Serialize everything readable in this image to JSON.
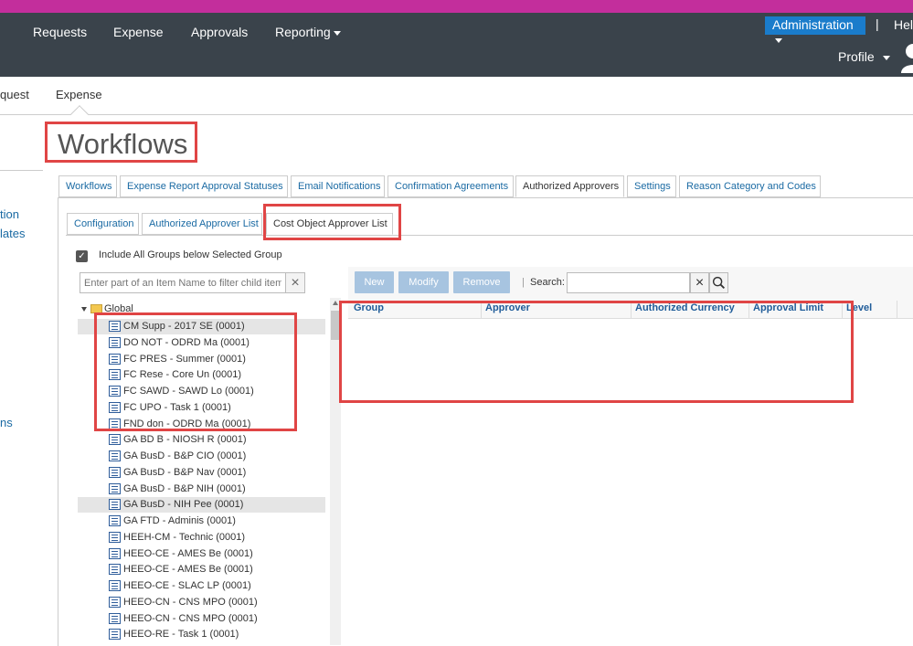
{
  "nav": {
    "items": [
      "Requests",
      "Expense",
      "Approvals",
      "Reporting"
    ],
    "admin": "Administration",
    "separator": "|",
    "help": "Hel",
    "profile": "Profile"
  },
  "subnav": {
    "requests": "quest",
    "expense": "Expense"
  },
  "page": {
    "title": "Workflows"
  },
  "left_menu": [
    "tion",
    "lates",
    "ns"
  ],
  "tabs": [
    "Workflows",
    "Expense Report Approval Statuses",
    "Email Notifications",
    "Confirmation Agreements",
    "Authorized Approvers",
    "Settings",
    "Reason Category and Codes"
  ],
  "subtabs": [
    "Configuration",
    "Authorized Approver List",
    "Cost Object Approver List"
  ],
  "checkbox": {
    "label": "Include All Groups below Selected Group",
    "checked": true
  },
  "filter": {
    "placeholder": "Enter part of an Item Name to filter child item"
  },
  "tree": {
    "root": "Global",
    "items": [
      "CM Supp - 2017 SE (0001)",
      "DO NOT - ODRD Ma (0001)",
      "FC PRES - Summer (0001)",
      "FC Rese - Core Un (0001)",
      "FC SAWD - SAWD Lo (0001)",
      "FC UPO - Task 1 (0001)",
      "FND don - ODRD Ma (0001)",
      "GA BD B - NIOSH R (0001)",
      "GA BusD - B&P CIO (0001)",
      "GA BusD - B&P Nav (0001)",
      "GA BusD - B&P NIH (0001)",
      "GA BusD - NIH Pee (0001)",
      "GA FTD - Adminis (0001)",
      "HEEH-CM - Technic (0001)",
      "HEEO-CE - AMES Be (0001)",
      "HEEO-CE - AMES Be (0001)",
      "HEEO-CE - SLAC LP (0001)",
      "HEEO-CN - CNS MPO (0001)",
      "HEEO-CN - CNS MPO (0001)",
      "HEEO-RE - Task 1 (0001)"
    ]
  },
  "toolbar": {
    "new": "New",
    "modify": "Modify",
    "remove": "Remove",
    "search_label": "Search:"
  },
  "grid": {
    "columns": [
      "Group",
      "Approver",
      "Authorized Currency",
      "Approval Limit",
      "Level"
    ]
  },
  "colors": {
    "topstrip": "#c32e9c",
    "nav_bg": "#3a434b",
    "admin": "#1a7ccb",
    "highlight": "#e04545"
  }
}
